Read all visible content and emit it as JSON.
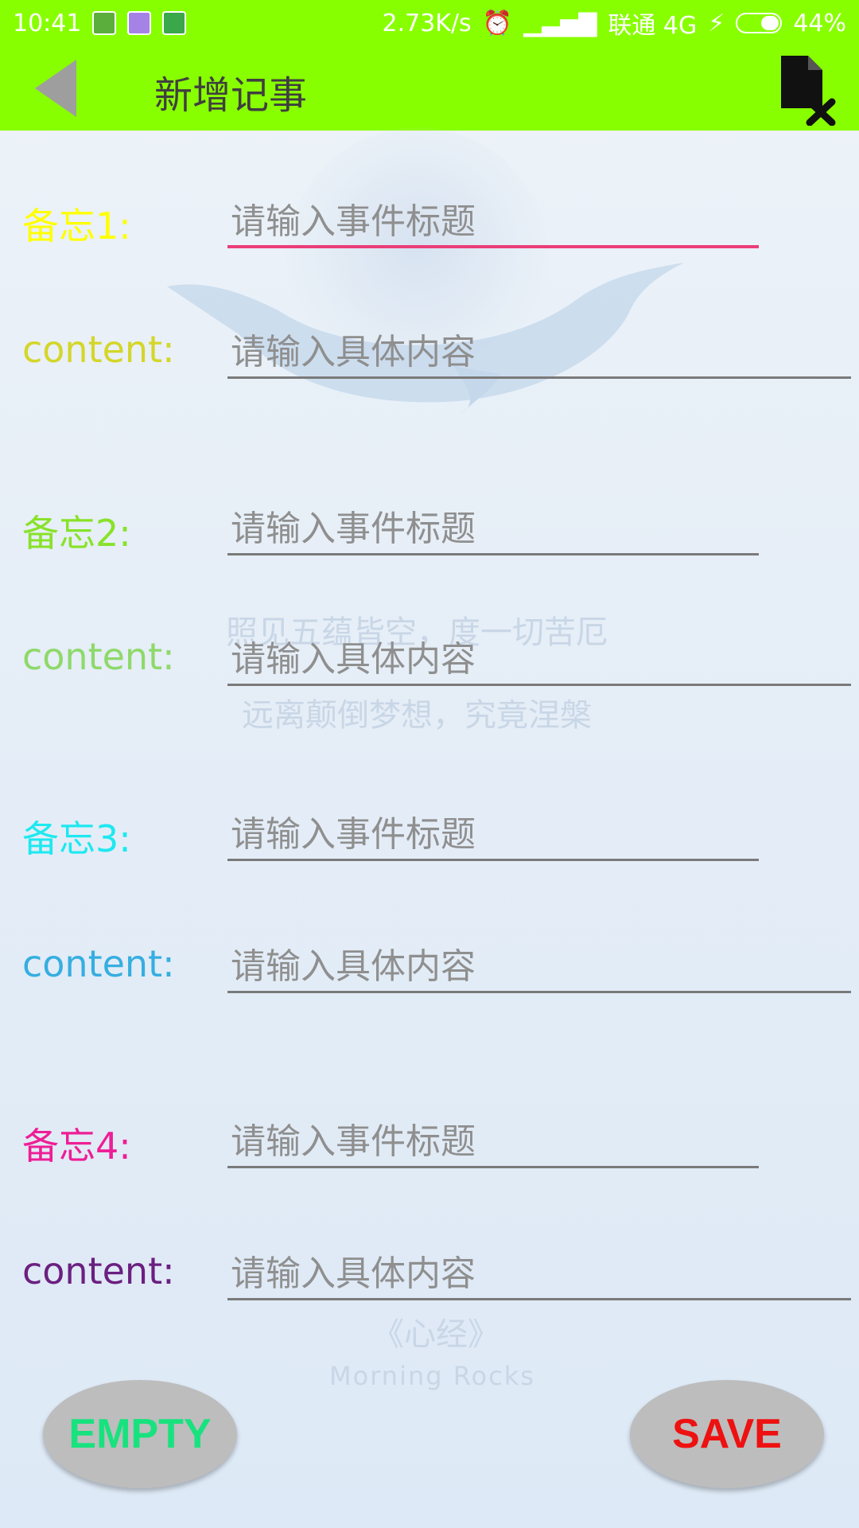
{
  "status_bar": {
    "time": "10:41",
    "net_speed": "2.73K/s",
    "carrier": "联通 4G",
    "battery": "44%"
  },
  "app_bar": {
    "title": "新增记事"
  },
  "background": {
    "poem_line1": "照见五蕴皆空，度一切苦厄",
    "poem_line2": "远离颠倒梦想，究竟涅槃",
    "poem_source": "《心经》",
    "poem_author": "Morning Rocks"
  },
  "memos": [
    {
      "label": "备忘1:",
      "content_label": "content:",
      "title_placeholder": "请输入事件标题",
      "content_placeholder": "请输入具体内容",
      "label_color": "#ffff00",
      "content_color": "#d4d62a"
    },
    {
      "label": "备忘2:",
      "content_label": "content:",
      "title_placeholder": "请输入事件标题",
      "content_placeholder": "请输入具体内容",
      "label_color": "#88e22a",
      "content_color": "#8ed96a"
    },
    {
      "label": "备忘3:",
      "content_label": "content:",
      "title_placeholder": "请输入事件标题",
      "content_placeholder": "请输入具体内容",
      "label_color": "#1ee8f0",
      "content_color": "#36aee0"
    },
    {
      "label": "备忘4:",
      "content_label": "content:",
      "title_placeholder": "请输入事件标题",
      "content_placeholder": "请输入具体内容",
      "label_color": "#ee1e96",
      "content_color": "#6b2080"
    }
  ],
  "buttons": {
    "empty": "EMPTY",
    "save": "SAVE"
  },
  "colors": {
    "bar": "#88ff00",
    "focus_underline": "#ea3e78"
  }
}
